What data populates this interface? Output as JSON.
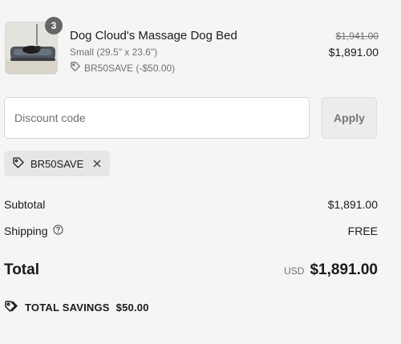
{
  "line_item": {
    "quantity": "3",
    "title": "Dog Cloud's Massage Dog Bed",
    "variant": "Small (29.5\" x 23.6\")",
    "discount": "BR50SAVE (-$50.00)",
    "compare_price": "$1,941.00",
    "price": "$1,891.00",
    "icons": {
      "discount": "tag-icon"
    }
  },
  "discount_form": {
    "placeholder": "Discount code",
    "value": "",
    "apply_label": "Apply"
  },
  "applied_discount": {
    "code": "BR50SAVE",
    "icons": {
      "tag": "tag-icon",
      "remove": "close-icon"
    }
  },
  "summary": {
    "subtotal_label": "Subtotal",
    "subtotal_value": "$1,891.00",
    "shipping_label": "Shipping",
    "shipping_value": "FREE",
    "total_label": "Total",
    "currency": "USD",
    "total_value": "$1,891.00"
  },
  "savings": {
    "label": "TOTAL SAVINGS",
    "value": "$50.00"
  },
  "colors": {
    "background": "#f5f5f5",
    "text": "#1a1a1a",
    "muted": "#707070",
    "badge": "#666666"
  }
}
